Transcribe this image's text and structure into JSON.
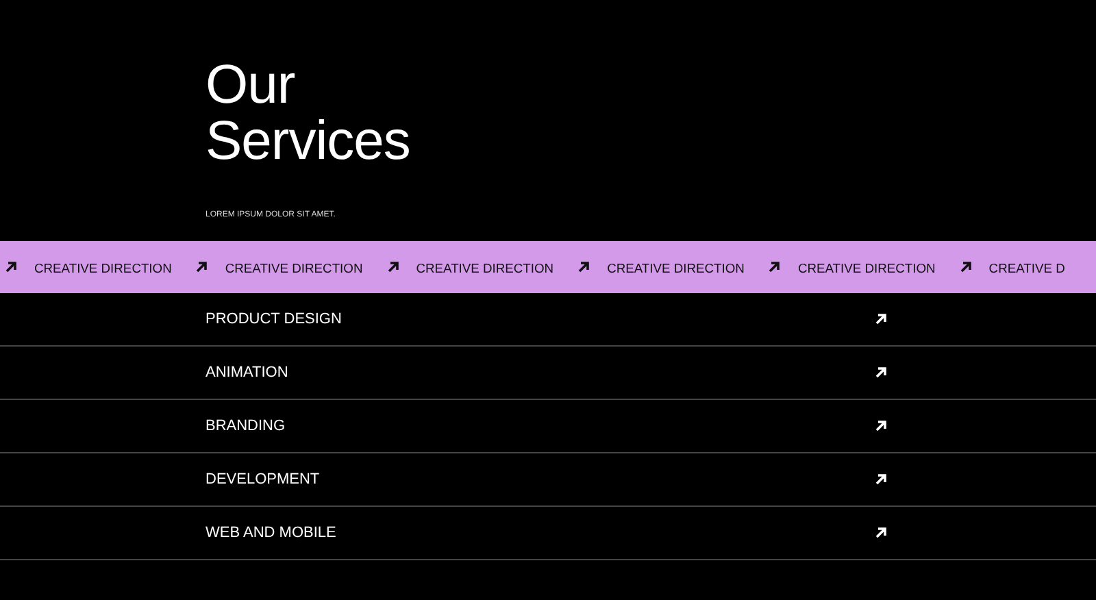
{
  "heading": {
    "title_lines": [
      "Our",
      "Services"
    ],
    "subtitle": "LOREM IPSUM DOLOR SIT AMET."
  },
  "marquee": {
    "items": [
      "CREATIVE DIRECTION",
      "CREATIVE DIRECTION",
      "CREATIVE DIRECTION",
      "CREATIVE DIRECTION",
      "CREATIVE DIRECTION",
      "CREATIVE D"
    ]
  },
  "services": [
    {
      "label": "PRODUCT DESIGN"
    },
    {
      "label": "ANIMATION"
    },
    {
      "label": "BRANDING"
    },
    {
      "label": "DEVELOPMENT"
    },
    {
      "label": "WEB AND MOBILE"
    }
  ]
}
